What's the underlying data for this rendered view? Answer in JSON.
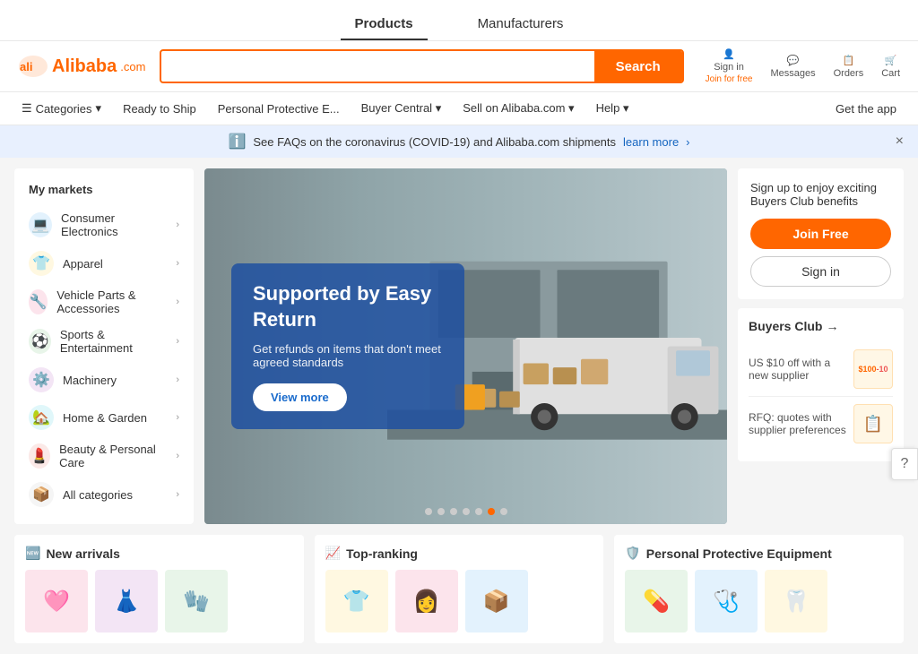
{
  "topnav": {
    "items": [
      {
        "label": "Products",
        "active": true
      },
      {
        "label": "Manufacturers",
        "active": false
      }
    ]
  },
  "header": {
    "logo": "Alibaba",
    "logo_com": ".com",
    "search_placeholder": "",
    "search_btn": "Search",
    "actions": [
      {
        "icon": "user-icon",
        "label": "Sign in",
        "sublabel": "Join for free"
      },
      {
        "icon": "messages-icon",
        "label": "Messages"
      },
      {
        "icon": "orders-icon",
        "label": "Orders"
      },
      {
        "icon": "cart-icon",
        "label": "Cart"
      }
    ]
  },
  "secondary_nav": {
    "categories": "Categories",
    "items": [
      "Ready to Ship",
      "Personal Protective E...",
      "Buyer Central",
      "Sell on Alibaba.com",
      "Help"
    ],
    "get_app": "Get the app"
  },
  "alert_bar": {
    "info_icon": "info-icon",
    "message": "See FAQs on the coronavirus (COVID-19) and Alibaba.com shipments",
    "link": "learn more",
    "close": "×"
  },
  "sidebar": {
    "title": "My markets",
    "items": [
      {
        "icon": "💻",
        "label": "Consumer Electronics"
      },
      {
        "icon": "👕",
        "label": "Apparel"
      },
      {
        "icon": "🔧",
        "label": "Vehicle Parts & Accessories"
      },
      {
        "icon": "⚽",
        "label": "Sports & Entertainment"
      },
      {
        "icon": "⚙️",
        "label": "Machinery"
      },
      {
        "icon": "🏡",
        "label": "Home & Garden"
      },
      {
        "icon": "💄",
        "label": "Beauty & Personal Care"
      },
      {
        "icon": "📦",
        "label": "All categories"
      }
    ]
  },
  "hero": {
    "title": "Supported by Easy Return",
    "subtitle": "Get refunds on items that don't meet agreed standards",
    "btn": "View more",
    "dots": 7,
    "active_dot": 5
  },
  "right_panel": {
    "club_text": "Sign up to enjoy exciting Buyers Club benefits",
    "join_btn": "Join Free",
    "signin_btn": "Sign in",
    "buyers_club_title": "Buyers Club",
    "benefits": [
      {
        "text": "US $10 off with a new supplier",
        "badge": "$100-10"
      },
      {
        "text": "RFQ: quotes with supplier preferences",
        "badge": "📋"
      }
    ]
  },
  "bottom": {
    "sections": [
      {
        "icon": "🆕",
        "title": "New arrivals",
        "products": [
          "🩷",
          "👗",
          "🧤"
        ]
      },
      {
        "icon": "📈",
        "title": "Top-ranking",
        "products": [
          "👕",
          "👩",
          "📦"
        ]
      },
      {
        "icon": "🛡️",
        "title": "Personal Protective Equipment",
        "products": [
          "💊",
          "🩺",
          "🦷"
        ]
      }
    ]
  },
  "help_icon": "?"
}
